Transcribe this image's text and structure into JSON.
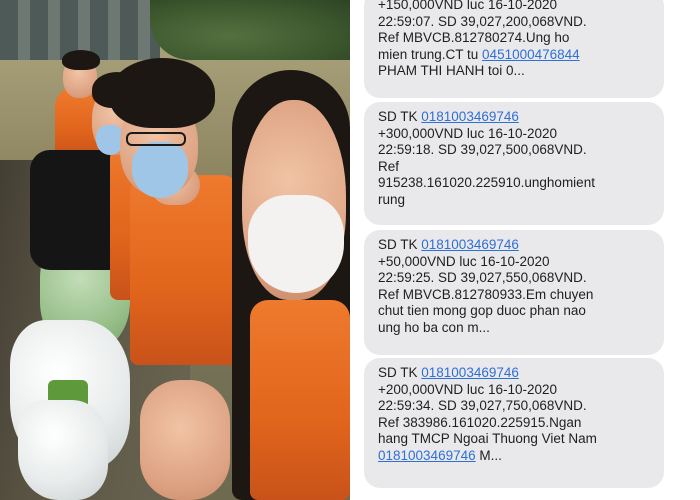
{
  "photo": {
    "description_icon": "photo-icon"
  },
  "messages": [
    {
      "lines": [
        {
          "text": "+150,000VND luc 16-10-2020"
        },
        {
          "text": "22:59:07. SD 39,027,200,068VND."
        },
        {
          "text": "Ref MBVCB.812780274.Ung ho"
        },
        {
          "prefix": "mien trung.CT tu ",
          "link": "0451000476844"
        },
        {
          "text": "PHAM THI HANH toi 0..."
        }
      ]
    },
    {
      "lines": [
        {
          "prefix": "SD TK ",
          "link": "0181003469746"
        },
        {
          "text": "+300,000VND luc 16-10-2020"
        },
        {
          "text": "22:59:18. SD 39,027,500,068VND."
        },
        {
          "text": "Ref"
        },
        {
          "text": "915238.161020.225910.unghomient"
        },
        {
          "text": "rung"
        }
      ]
    },
    {
      "lines": [
        {
          "prefix": "SD TK ",
          "link": "0181003469746"
        },
        {
          "text": "+50,000VND luc 16-10-2020"
        },
        {
          "text": "22:59:25. SD 39,027,550,068VND."
        },
        {
          "text": "Ref MBVCB.812780933.Em chuyen"
        },
        {
          "text": "chut tien mong gop duoc phan nao"
        },
        {
          "text": "ung ho ba con m..."
        }
      ]
    },
    {
      "lines": [
        {
          "prefix": "SD TK ",
          "link": "0181003469746"
        },
        {
          "text": "+200,000VND luc 16-10-2020"
        },
        {
          "text": "22:59:34. SD 39,027,750,068VND."
        },
        {
          "text": "Ref 383986.161020.225915.Ngan"
        },
        {
          "text": "hang TMCP Ngoai Thuong Viet Nam"
        },
        {
          "link": "0181003469746",
          "suffix": " M..."
        }
      ]
    }
  ],
  "colors": {
    "bubble": "#e9e9eb",
    "link": "#2f6fd8",
    "vest": "#e1651c"
  }
}
